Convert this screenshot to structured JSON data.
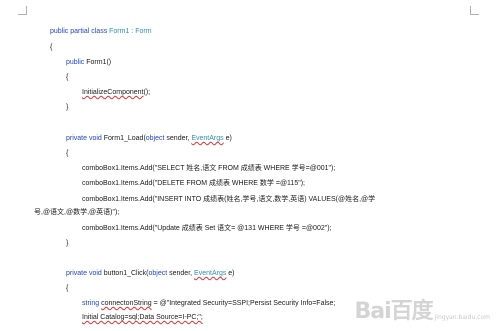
{
  "document": {
    "lines": {
      "l01": {
        "a": "public partial class ",
        "b": "Form1 : Form"
      },
      "l02": {
        "a": "{"
      },
      "l03": {
        "a": "public ",
        "b": "Form1()"
      },
      "l04": {
        "a": "{"
      },
      "l05": {
        "a": "InitializeComponent",
        "b": "();"
      },
      "l06": {
        "a": "}"
      },
      "l07": {
        "a": "private void ",
        "b": "Form1_Load(",
        "c": "object",
        "d": " sender, ",
        "e": "EventArgs",
        "f": " e)"
      },
      "l08": {
        "a": "{"
      },
      "l09": {
        "a": "comboBox1.Items.Add(\"SELECT  姓名,语文  FROM  成绩表  WHERE  学号=@001\");"
      },
      "l10": {
        "a": "comboBox1.Items.Add(\"DELETE FROM  成绩表  WHERE  数学  =@115\");"
      },
      "l11": {
        "a": "comboBox1.Items.Add(\"INSERT INTO  成绩表(姓名,学号,语文,数学,英语) VALUES(@姓名,@学"
      },
      "l12": {
        "a": "号,@语文,@数学,@英语)\");"
      },
      "l13": {
        "a": "comboBox1.Items.Add(\"Update  成绩表  Set  语文= @131 WHERE  学号  =@002\");"
      },
      "l14": {
        "a": "}"
      },
      "l15": {
        "a": "private void ",
        "b": "button1_Click(",
        "c": "object",
        "d": " sender, ",
        "e": "EventArgs",
        "f": " e)"
      },
      "l16": {
        "a": "{"
      },
      "l17": {
        "a": "string ",
        "b": "connectonString",
        "c": " = @\"Integrated Security=SSPI;Persist Security Info=False;"
      },
      "l18": {
        "a": "Initial Catalog=sql;Data Source=I-PC;\";"
      }
    }
  },
  "watermark": {
    "logo": "Bai百度",
    "sub": "jingyan.baidu.com"
  },
  "colors": {
    "keyword": "#1f47c8",
    "type": "#2b91af",
    "text": "#1a1a1a",
    "squiggle": "#e03030"
  }
}
